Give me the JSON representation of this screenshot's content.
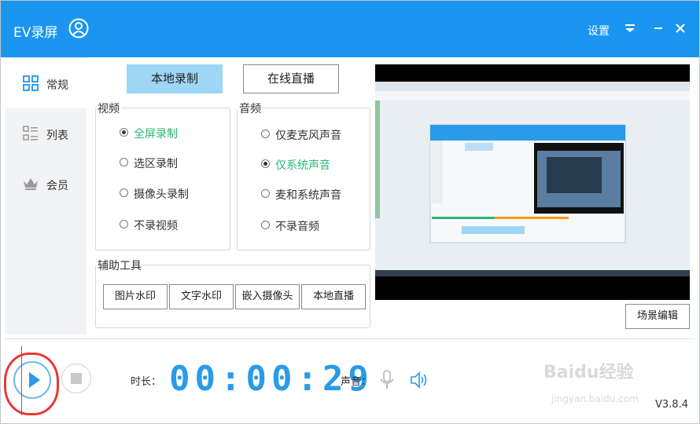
{
  "app": {
    "title": "EV录屏",
    "settings_label": "设置",
    "version": "V3.8.4"
  },
  "sidebar": {
    "items": [
      {
        "label": "常规",
        "icon": "grid-icon",
        "active": true
      },
      {
        "label": "列表",
        "icon": "list-icon",
        "active": false
      },
      {
        "label": "会员",
        "icon": "crown-icon",
        "active": false
      }
    ]
  },
  "modes": {
    "local": "本地录制",
    "live": "在线直播"
  },
  "video": {
    "title": "视频",
    "options": [
      {
        "label": "全屏录制",
        "checked": true
      },
      {
        "label": "选区录制",
        "checked": false
      },
      {
        "label": "摄像头录制",
        "checked": false
      },
      {
        "label": "不录视频",
        "checked": false
      }
    ]
  },
  "audio": {
    "title": "音频",
    "options": [
      {
        "label": "仅麦克风声音",
        "checked": false
      },
      {
        "label": "仅系统声音",
        "checked": true
      },
      {
        "label": "麦和系统声音",
        "checked": false
      },
      {
        "label": "不录音频",
        "checked": false
      }
    ]
  },
  "tools": {
    "title": "辅助工具",
    "buttons": [
      "图片水印",
      "文字水印",
      "嵌入摄像头",
      "本地直播"
    ]
  },
  "scene_edit": "场景编辑",
  "controls": {
    "duration_label": "时长：",
    "timer": "00:00:29",
    "volume_label": "声音："
  },
  "watermark": {
    "brand": "Baidu经验",
    "url": "jingyan.baidu.com"
  },
  "colors": {
    "accent": "#1a96f0",
    "checked_text": "#2bb673",
    "timer": "#2a9be8"
  }
}
